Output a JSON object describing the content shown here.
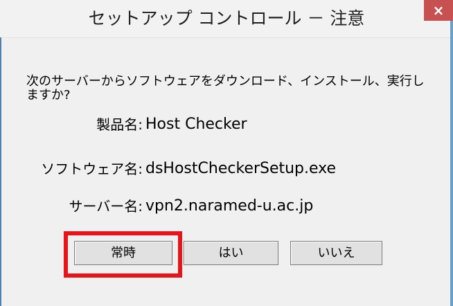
{
  "window": {
    "title": "セットアップ コントロール － 注意",
    "close_label": "×"
  },
  "message": "次のサーバーからソフトウェアをダウンロード、インストール、実行しますか?",
  "info": {
    "product_label": "製品名:",
    "product_value": "Host Checker",
    "software_label": "ソフトウェア名:",
    "software_value": "dsHostCheckerSetup.exe",
    "server_label": "サーバー名:",
    "server_value": "vpn2.naramed-u.ac.jp"
  },
  "buttons": {
    "always": "常時",
    "yes": "はい",
    "no": "いいえ"
  },
  "highlight_color": "#e8141b"
}
